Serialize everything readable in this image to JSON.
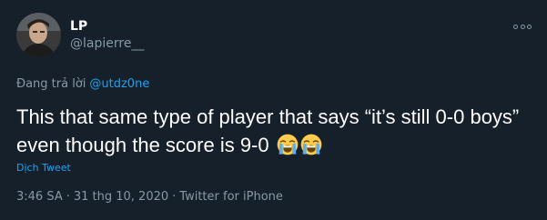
{
  "user": {
    "display_name": "LP",
    "handle": "@lapierre__"
  },
  "reply": {
    "prefix": "Đang trả lời",
    "to": "@utdz0ne"
  },
  "tweet": {
    "text": "This that same type of player that says “it’s still 0-0 boys” even though the score is 9-0",
    "emojis": [
      "loudly-crying-face",
      "loudly-crying-face"
    ]
  },
  "translate_label": "Dịch Tweet",
  "meta": {
    "time": "3:46 SA",
    "date": "31 thg 10, 2020",
    "source": "Twitter for iPhone",
    "separator": "·"
  },
  "colors": {
    "background": "#15202b",
    "text": "#ffffff",
    "secondary": "#8899a6",
    "link": "#1da1f2"
  }
}
